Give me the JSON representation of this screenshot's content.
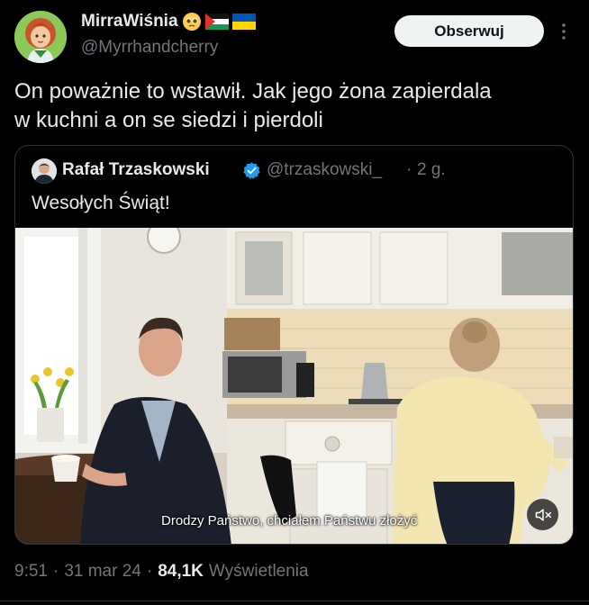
{
  "author": {
    "display_name": "MirraWiśnia",
    "name_emojis": [
      "pleading-face-emoji",
      "palestine-flag",
      "ukraine-flag"
    ],
    "handle": "@Myrrhandcherry"
  },
  "follow_label": "Obserwuj",
  "tweet": {
    "line1": "On poważnie to wstawił. Jak jego żona zapierdala",
    "line2": "w kuchni a on se siedzi i pierdoli"
  },
  "quote": {
    "name": "Rafał Trzaskowski",
    "handle": "@trzaskowski_",
    "separator": "·",
    "time": "2 g.",
    "text": "Wesołych Świąt!",
    "video_caption": "Drodzy Państwo, chciałem Państwu złożyć"
  },
  "meta": {
    "time": "9:51",
    "sep1": "·",
    "date": "31 mar 24",
    "sep2": "·",
    "views_count": "84,1K",
    "views_label": "Wyświetlenia"
  },
  "colors": {
    "background": "#000000",
    "text": "#e7e9ea",
    "secondary": "#71767b",
    "verified": "#1d9bf0",
    "follow_bg": "#eff3f4"
  }
}
